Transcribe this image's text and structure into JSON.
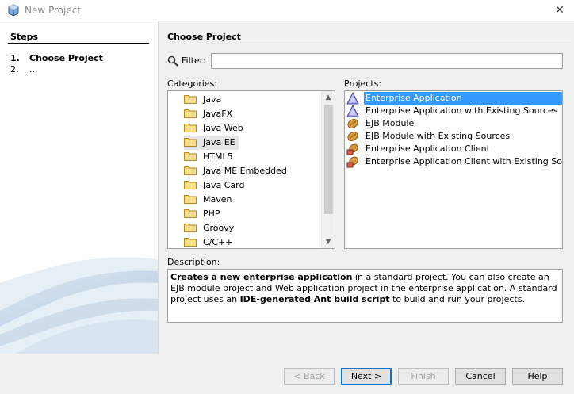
{
  "window": {
    "title": "New Project",
    "icon": "netbeans-cube-icon"
  },
  "steps": {
    "title": "Steps",
    "items": [
      {
        "num": "1.",
        "label": "Choose Project"
      },
      {
        "num": "2.",
        "label": "..."
      }
    ]
  },
  "main": {
    "title": "Choose Project",
    "filter": {
      "label": "Filter:",
      "value": "",
      "placeholder": ""
    },
    "categories_label": "Categories:",
    "projects_label": "Projects:",
    "categories": [
      "Java",
      "JavaFX",
      "Java Web",
      "Java EE",
      "HTML5",
      "Java ME Embedded",
      "Java Card",
      "Maven",
      "PHP",
      "Groovy",
      "C/C++"
    ],
    "selected_category": "Java EE",
    "projects": [
      {
        "label": "Enterprise Application",
        "icon": "enterprise-app-icon"
      },
      {
        "label": "Enterprise Application with Existing Sources",
        "icon": "enterprise-app-icon"
      },
      {
        "label": "EJB Module",
        "icon": "ejb-bean-icon"
      },
      {
        "label": "EJB Module with Existing Sources",
        "icon": "ejb-bean-icon"
      },
      {
        "label": "Enterprise Application Client",
        "icon": "app-client-icon"
      },
      {
        "label": "Enterprise Application Client with Existing Sources",
        "icon": "app-client-icon"
      }
    ],
    "selected_project": "Enterprise Application",
    "description_label": "Description:",
    "description": {
      "b1": "Creates a new enterprise application",
      "t1": " in a standard project. You can also create an EJB module project and Web application project in the enterprise application. A standard project uses an ",
      "b2": "IDE-generated Ant build script",
      "t2": " to build and run your projects."
    }
  },
  "buttons": {
    "back": "< Back",
    "next": "Next >",
    "finish": "Finish",
    "cancel": "Cancel",
    "help": "Help"
  },
  "colors": {
    "selection": "#3399ff",
    "default_button_border": "#0078d7"
  }
}
